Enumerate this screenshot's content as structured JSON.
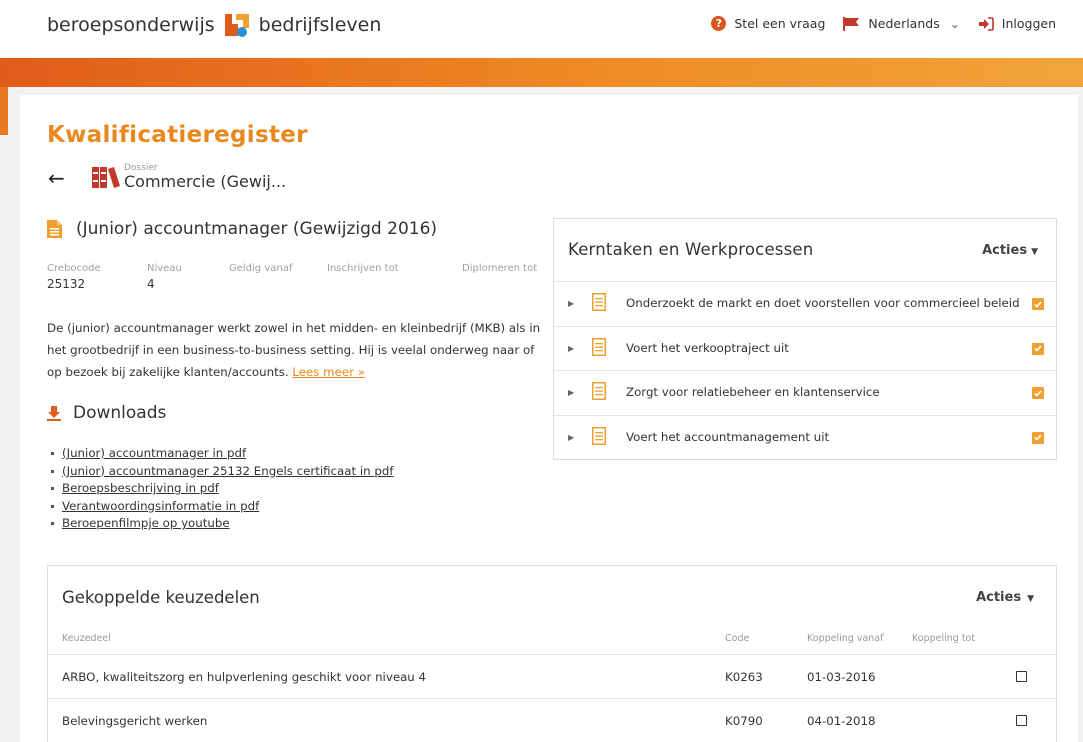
{
  "header": {
    "logo_left": "beroepsonderwijs",
    "logo_right": "bedrijfsleven",
    "ask_label": "Stel een vraag",
    "language_label": "Nederlands",
    "login_label": "Inloggen"
  },
  "page": {
    "title": "Kwalificatieregister",
    "dossier_caption": "Dossier",
    "dossier_name": "Commercie (Gewij..."
  },
  "qualification": {
    "title": "(Junior) accountmanager (Gewijzigd 2016)",
    "meta": {
      "crebocode_label": "Crebocode",
      "crebocode_value": "25132",
      "niveau_label": "Niveau",
      "niveau_value": "4",
      "geldig_label": "Geldig vanaf",
      "inschrijven_label": "Inschrijven tot",
      "diplomeren_label": "Diplomeren tot"
    },
    "description": "De (junior) accountmanager werkt zowel in het midden- en kleinbedrijf (MKB) als in het grootbedrijf in een business-to-business setting. Hij is veelal onderweg naar of op bezoek bij zakelijke klanten/accounts.",
    "read_more": "Lees meer »"
  },
  "downloads": {
    "heading": "Downloads",
    "items": [
      "(Junior) accountmanager in pdf",
      "(Junior) accountmanager 25132 Engels certificaat in pdf",
      "Beroepsbeschrijving in pdf",
      "Verantwoordingsinformatie in pdf",
      "Beroepenfilmpje op youtube"
    ]
  },
  "kerntaken": {
    "title": "Kerntaken en Werkprocessen",
    "actions_label": "Acties",
    "items": [
      "Onderzoekt de markt en doet voorstellen voor commercieel beleid",
      "Voert het verkooptraject uit",
      "Zorgt voor relatiebeheer en klantenservice",
      "Voert het accountmanagement uit"
    ]
  },
  "keuzedelen": {
    "title": "Gekoppelde keuzedelen",
    "actions_label": "Acties",
    "columns": {
      "keuzedeel": "Keuzedeel",
      "code": "Code",
      "vanaf": "Koppeling vanaf",
      "tot": "Koppeling tot"
    },
    "rows": [
      {
        "name": "ARBO, kwaliteitszorg en hulpverlening geschikt voor niveau 4",
        "code": "K0263",
        "vanaf": "01-03-2016",
        "tot": ""
      },
      {
        "name": "Belevingsgericht werken",
        "code": "K0790",
        "vanaf": "04-01-2018",
        "tot": ""
      }
    ]
  },
  "colors": {
    "accent_orange": "#e8891f",
    "check_orange": "#f0a030",
    "banner_red": "#e05c1a"
  }
}
